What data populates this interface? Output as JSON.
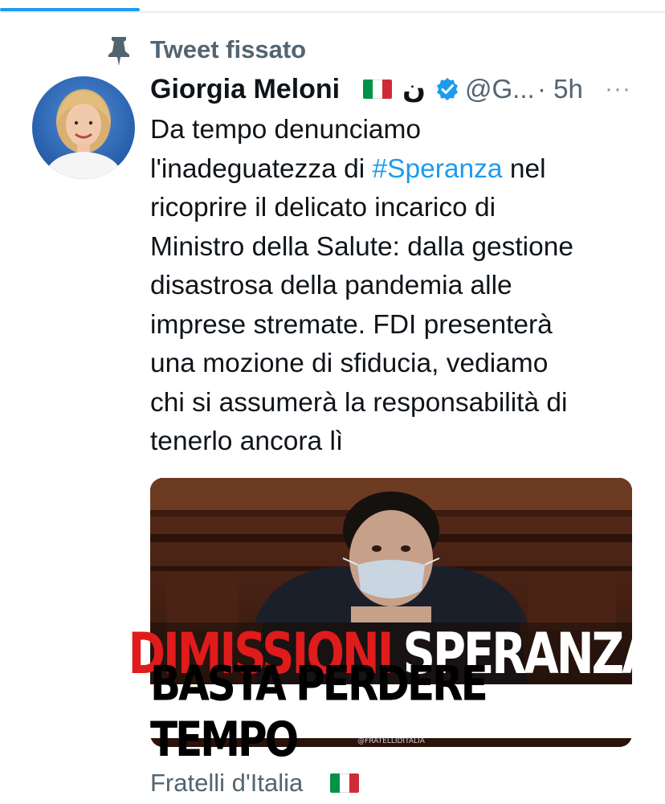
{
  "pinned_label": "Tweet fissato",
  "author": {
    "display_name": "Giorgia Meloni",
    "arabic_nun": "ن",
    "handle": "@G...",
    "time": "· 5h",
    "more": "···"
  },
  "tweet": {
    "text_lines": [
      [
        "Da tempo denunciamo"
      ],
      [
        "l'inadeguatezza di ",
        "#Speranza",
        " nel"
      ],
      [
        "ricoprire il delicato incarico di"
      ],
      [
        "Ministro della Salute: dalla gestione"
      ],
      [
        "disastrosa della pandemia alle"
      ],
      [
        "imprese stremate. FDI presenterà"
      ],
      [
        "una mozione di sfiducia, vediamo"
      ],
      [
        "chi si assumerà la responsabilità di"
      ],
      [
        "tenerlo ancora lì"
      ]
    ],
    "line1": "Da tempo denunciamo",
    "line2_before": "l'inadeguatezza di ",
    "hashtag": "#Speranza",
    "line2_after": " nel",
    "line3": "ricoprire il delicato incarico di",
    "line4": "Ministro della Salute: dalla gestione",
    "line5": "disastrosa della pandemia alle",
    "line6": "imprese stremate. FDI presenterà",
    "line7": "una mozione di sfiducia, vediamo",
    "line8": "chi si assumerà la responsabilità di",
    "line9": "tenerlo ancora lì"
  },
  "media": {
    "caption_red": "DIMISSIONI",
    "caption_white": "SPERANZA",
    "caption_bottom": "BASTA PERDERE TEMPO",
    "watermark": "@FRATELLIDITALIA"
  },
  "next_tweet": {
    "display_name": "Fratelli d'Italia"
  },
  "colors": {
    "accent": "#1d9bf0",
    "secondary_text": "#536471",
    "flag_green": "#009246",
    "flag_white": "#ffffff",
    "flag_red": "#ce2b37",
    "caption_red": "#e01b1b"
  },
  "icons": [
    "pin-icon",
    "italian-flag-icon",
    "verified-badge-icon",
    "more-options-icon"
  ]
}
